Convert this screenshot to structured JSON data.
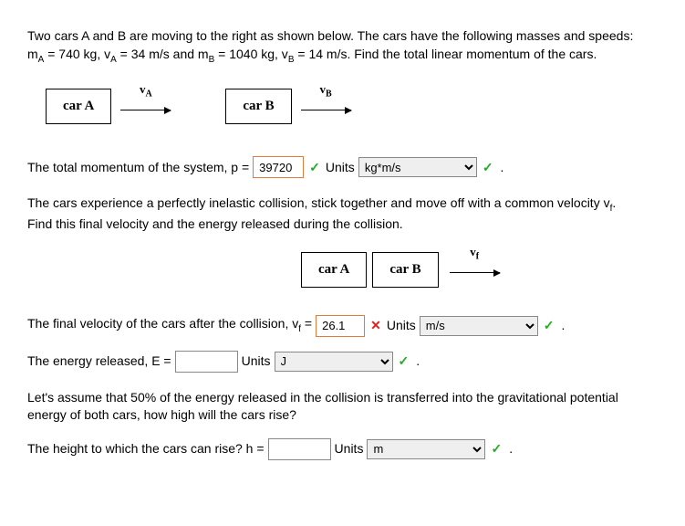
{
  "intro": {
    "line1": "Two cars A and B are moving to the right as shown below. The cars have the following masses and speeds:",
    "line2_pre": "m",
    "line2_subA": "A",
    "line2_part2": " = 740 kg, v",
    "line2_subA2": "A",
    "line2_part3": " = 34 m/s and m",
    "line2_subB": "B",
    "line2_part4": " = 1040 kg, v",
    "line2_subB2": "B",
    "line2_part5": " = 14 m/s. Find the total linear momentum of the cars."
  },
  "diagram": {
    "carA": "car A",
    "carB": "car B",
    "vA_label_v": "v",
    "vA_label_sub": "A",
    "vB_label_v": "v",
    "vB_label_sub": "B",
    "vf_label_v": "v",
    "vf_label_sub": "f"
  },
  "q1": {
    "prompt": "The total momentum of the system, p = ",
    "value": "39720",
    "units_label": "Units",
    "units_value": "kg*m/s"
  },
  "mid_text": {
    "l1": "The cars experience a perfectly inelastic collision, stick together and move off with a common velocity v",
    "l1_sub": "f",
    "l1_end": ".",
    "l2": "Find this final velocity and the energy released during the collision."
  },
  "q2": {
    "prompt_pre": "The final velocity of the cars after the collision, v",
    "prompt_sub": "f",
    "prompt_post": " = ",
    "value": "26.1",
    "units_label": "Units",
    "units_value": "m/s"
  },
  "q3": {
    "prompt": "The energy released, E = ",
    "units_label": "Units",
    "units_value": "J"
  },
  "q4_intro": {
    "l1": "Let's assume that 50% of the energy released in the collision is transferred into the gravitational potential",
    "l2": "energy of both cars, how high will the cars rise?"
  },
  "q4": {
    "prompt": "The height to which the cars can rise? h = ",
    "units_label": "Units",
    "units_value": "m"
  },
  "marks": {
    "check": "✓",
    "cross": "✕",
    "period": "."
  }
}
